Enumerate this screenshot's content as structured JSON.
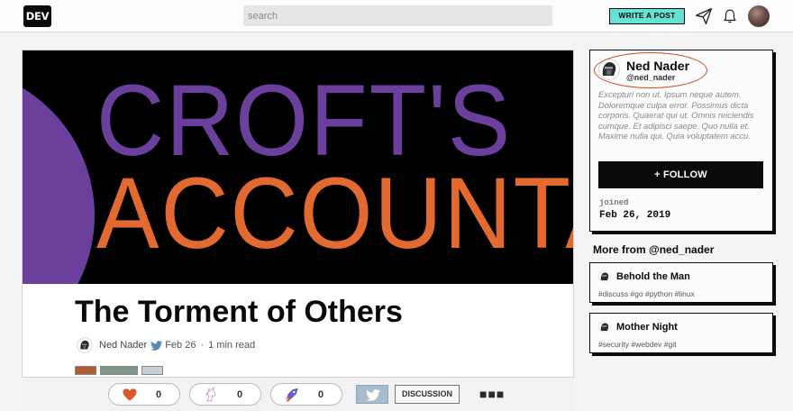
{
  "header": {
    "logo": "DEV",
    "search_placeholder": "search",
    "write_post_label": "WRITE A POST",
    "icons": [
      "paper-plane-icon",
      "bell-icon",
      "user-avatar"
    ]
  },
  "article": {
    "cover_line1": "CROFT'S",
    "cover_line2": "ACCOUNTA",
    "title": "The Torment of Others",
    "author": "Ned Nader",
    "date": "Feb 26",
    "separator": "·",
    "read_time": "1 min read"
  },
  "reactions": {
    "heart_count": "0",
    "unicorn_count": "0",
    "bookmark_count": "0",
    "discussion_label": "DISCUSSION",
    "more_label": "■■■"
  },
  "profile": {
    "name": "Ned Nader",
    "handle": "@ned_nader",
    "bio": "Excepturi non ut. Ipsum neque autem. Doloremque culpa error. Possimus dicta corporis. Quaerat qui ut. Omnis reiciendis cumque. Et adipisci saepe. Quo nulla et. Maxime nulla qui. Quia voluptatem accu.",
    "follow_label": "+ FOLLOW",
    "joined_label": "joined",
    "joined_date": "Feb 26, 2019"
  },
  "more_from": {
    "heading": "More from @ned_nader",
    "posts": [
      {
        "title": "Behold the Man",
        "tags": "#discuss #go #python #linux"
      },
      {
        "title": "Mother Night",
        "tags": "#security #webdev #git"
      }
    ]
  },
  "colors": {
    "accent_teal": "#66e2d5",
    "cover_purple": "#6b3f9c",
    "cover_orange": "#e2692f",
    "annotation_red": "#d24520"
  }
}
